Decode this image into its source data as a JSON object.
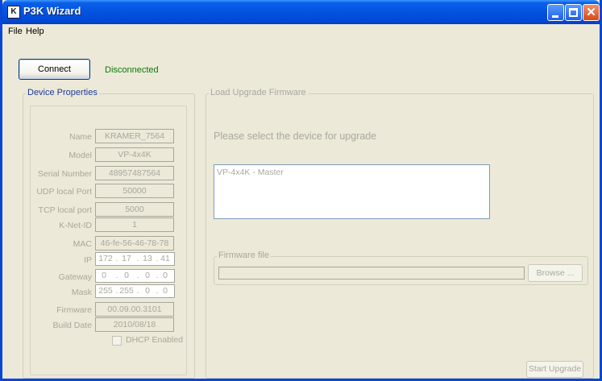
{
  "window": {
    "title": "P3K Wizard",
    "icon_letters": "K",
    "controls": {
      "minimize": "minimize-icon",
      "maximize": "maximize-icon",
      "close": "close-icon"
    }
  },
  "menu": {
    "file": "File",
    "help": "Help"
  },
  "connection": {
    "button_label": "Connect",
    "status": "Disconnected",
    "status_color": "#0a7a0a"
  },
  "device_properties": {
    "legend": "Device Properties",
    "fields": [
      {
        "label": "Name",
        "value": "KRAMER_7564"
      },
      {
        "label": "Model",
        "value": "VP-4x4K"
      },
      {
        "label": "Serial Number",
        "value": "48957487564"
      },
      {
        "label": "UDP local Port",
        "value": "50000"
      },
      {
        "label": "TCP local port",
        "value": "5000"
      },
      {
        "label": "K-Net-ID",
        "value": "1"
      },
      {
        "label": "MAC",
        "value": "46-fe-56-46-78-78"
      }
    ],
    "ip": {
      "label": "IP",
      "octets": [
        "172",
        "17",
        "13",
        "41"
      ]
    },
    "gateway": {
      "label": "Gateway",
      "octets": [
        "0",
        "0",
        "0",
        "0"
      ]
    },
    "mask": {
      "label": "Mask",
      "octets": [
        "255",
        "255",
        "0",
        "0"
      ]
    },
    "firmware": {
      "label": "Firmware",
      "value": "00.09.00.3101"
    },
    "build_date": {
      "label": "Build Date",
      "value": "2010/08/18"
    },
    "dhcp": {
      "label": "DHCP Enabled",
      "checked": false
    }
  },
  "upgrade": {
    "legend": "Load Upgrade Firmware",
    "prompt": "Please select the device for upgrade",
    "devices": [
      "VP-4x4K - Master"
    ],
    "firmware_file": {
      "legend": "Firmware file",
      "value": "",
      "browse_label": "Browse ..."
    },
    "start_label": "Start Upgrade"
  },
  "colors": {
    "titlebar": "#0353e0",
    "window_bg": "#ece9d8",
    "disabled_text": "#a8a79c",
    "legend_blue": "#1c3a9a"
  }
}
